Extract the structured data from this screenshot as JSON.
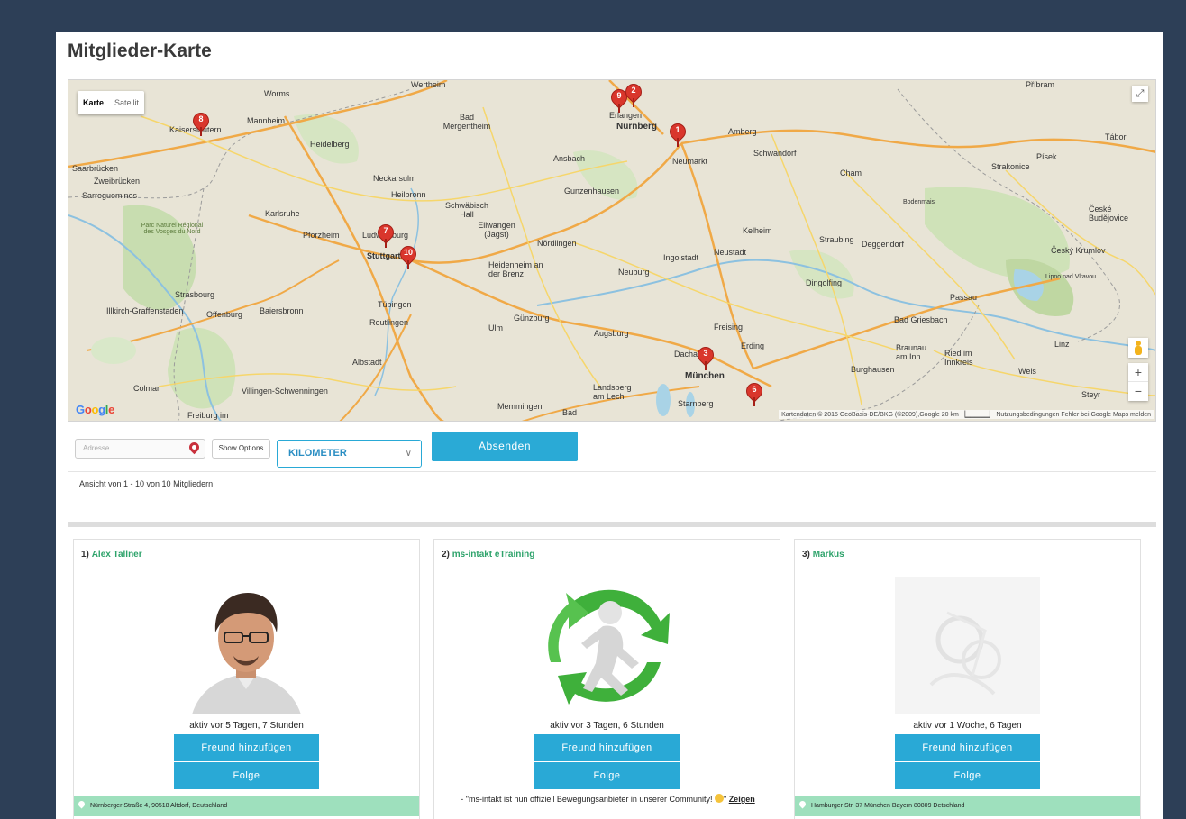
{
  "page": {
    "title": "Mitglieder-Karte"
  },
  "map": {
    "type_karte": "Karte",
    "type_satellit": "Satellit",
    "logo": "Google",
    "attribution": "Kartendaten © 2015 GeoBasis-DE/BKG (©2009),Google   20 km ▕▁▁▁▁▁▏   Nutzungsbedingungen   Fehler bei Google Maps melden",
    "zoom_in": "+",
    "zoom_out": "−",
    "fullscreen": "⤢",
    "markers": [
      "1",
      "2",
      "3",
      "6",
      "7",
      "8",
      "9",
      "10"
    ],
    "cities": [
      "Worms",
      "Mannheim",
      "Heidelberg",
      "Kaiserslautern",
      "Saarbrücken",
      "Zweibrücken",
      "Sarreguemines",
      "Karlsruhe",
      "Pforzheim",
      "Ludwigsburg",
      "Stuttgart",
      "Heilbronn",
      "Neckarsulm",
      "Strasbourg",
      "Offenburg",
      "Illkirch-Graffenstaden",
      "Baiersbronn",
      "Tübingen",
      "Reutlingen",
      "Albstadt",
      "Villingen-Schwenningen",
      "Freiburg im",
      "Colmar",
      "Bad Mergentheim",
      "Schwäbisch Hall",
      "Ellwangen (Jagst)",
      "Heidenheim an der Brenz",
      "Nördlingen",
      "Ansbach",
      "Gunzenhausen",
      "Erlangen",
      "Nürnberg",
      "Amberg",
      "Neumarkt",
      "Schwandorf",
      "Cham",
      "Straubing",
      "Deggendorf",
      "Dingolfing",
      "Passau",
      "Kelheim",
      "Ingolstadt",
      "Neustadt",
      "Neuburg",
      "Günzburg",
      "Ulm",
      "Augsburg",
      "Freising",
      "Erding",
      "Dachau",
      "München",
      "Landsberg am Lech",
      "Memmingen",
      "Starnberg",
      "Bad Griesbach",
      "Braunau am Inn",
      "Ried im Innkreis",
      "Wels",
      "Linz",
      "Steyr",
      "Burghausen",
      "Strakonice",
      "Písek",
      "Tábor",
      "České Budějovice",
      "Český Krumlov",
      "Lipno nad Vltavou",
      "Příbram",
      "Bodenmais",
      "Parc Naturel Régional des Vosges du Nord",
      "Wertheim",
      "Bad"
    ]
  },
  "search": {
    "address_placeholder": "Adresse...",
    "show_options": "Show Options",
    "unit": "KILOMETER",
    "submit": "Absenden"
  },
  "results": {
    "count_text": "Ansicht von 1 - 10 von 10 Mitgliedern"
  },
  "members": [
    {
      "index": "1)",
      "name": "Alex Tallner",
      "status": "aktiv vor 5 Tagen, 7 Stunden",
      "friend_label": "Freund hinzufügen",
      "follow_label": "Folge",
      "address": "Nürnberger Straße 4, 90518 Altdorf, Deutschland"
    },
    {
      "index": "2)",
      "name": "ms-intakt eTraining",
      "status": "aktiv vor 3 Tagen, 6 Stunden",
      "friend_label": "Freund hinzufügen",
      "follow_label": "Folge",
      "quote": "- \"ms-intakt ist nun offiziell Bewegungsanbieter in unserer Community!",
      "quote_end": "\"",
      "quote_link": "Zeigen"
    },
    {
      "index": "3)",
      "name": "Markus",
      "status": "aktiv vor 1 Woche, 6 Tagen",
      "friend_label": "Freund hinzufügen",
      "follow_label": "Folge",
      "address": "Hamburger Str. 37 München Bayern 80809 Detschland"
    }
  ]
}
